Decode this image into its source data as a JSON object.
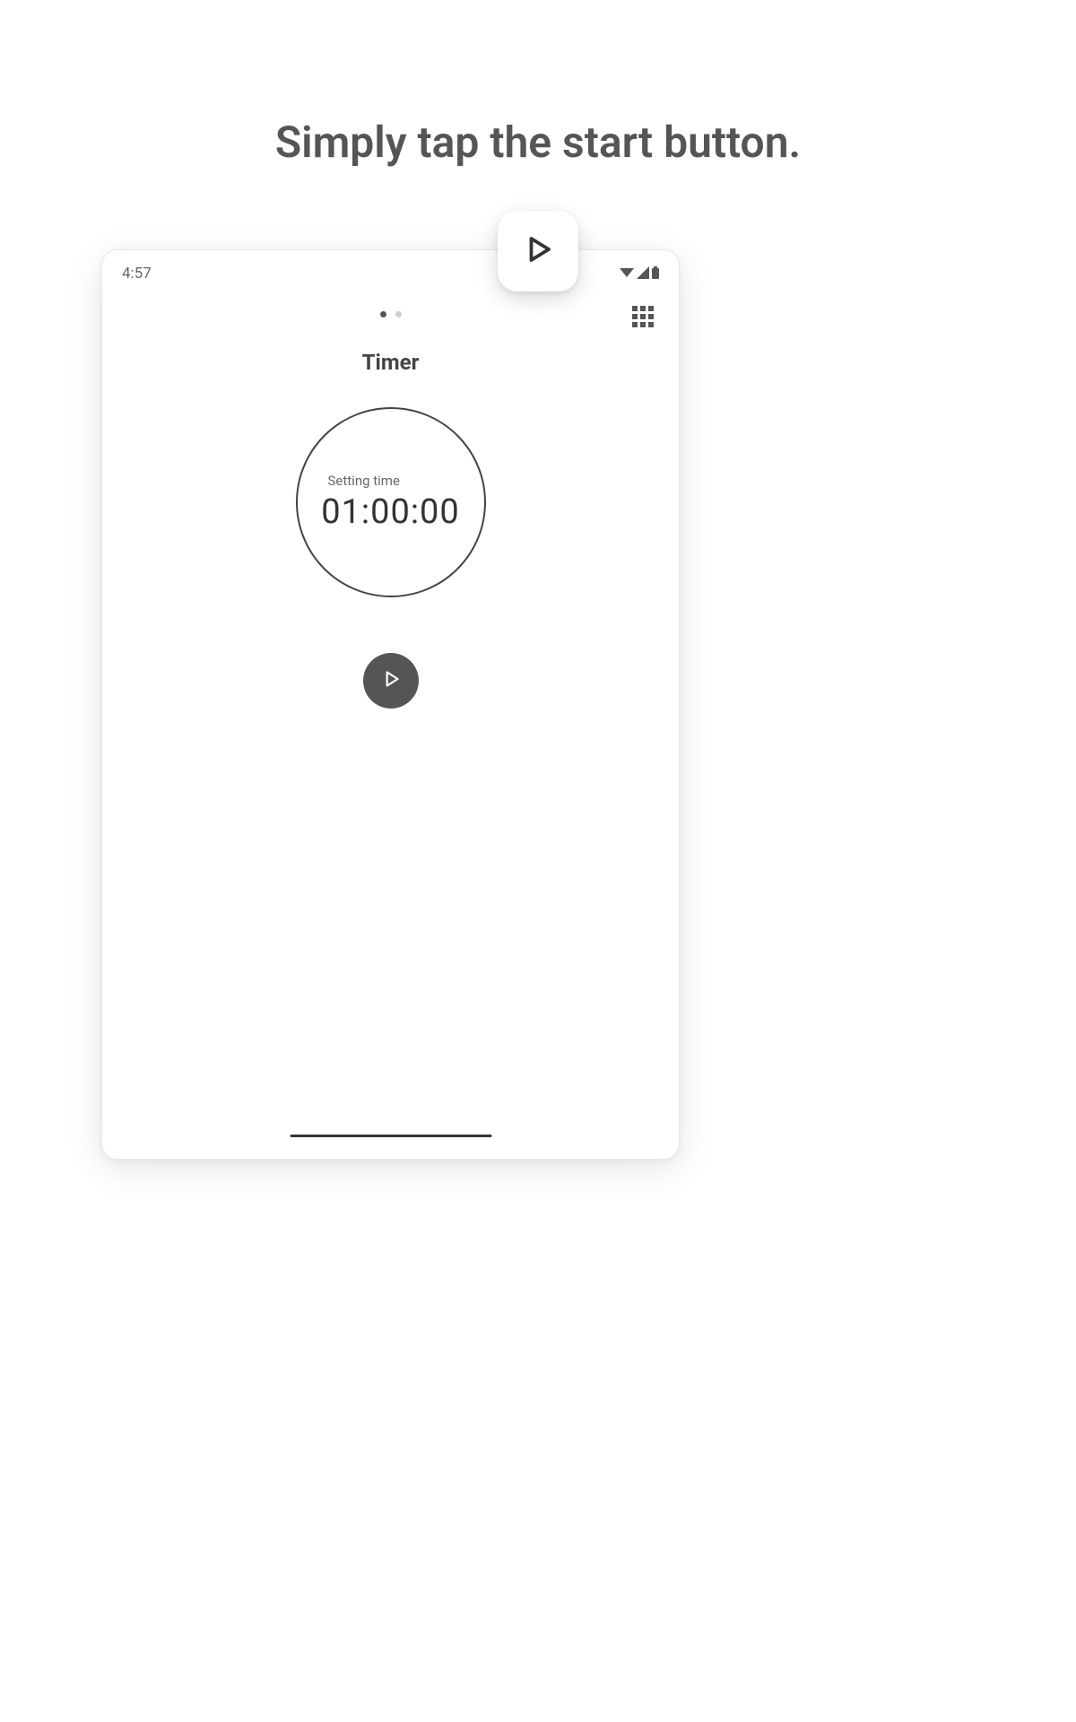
{
  "headline": "Simply tap the start button.",
  "status": {
    "time": "4:57"
  },
  "app": {
    "title": "Timer",
    "setting_label": "Setting time",
    "time_value": "01:00:00"
  },
  "pagination": {
    "current": 0,
    "total": 2
  }
}
